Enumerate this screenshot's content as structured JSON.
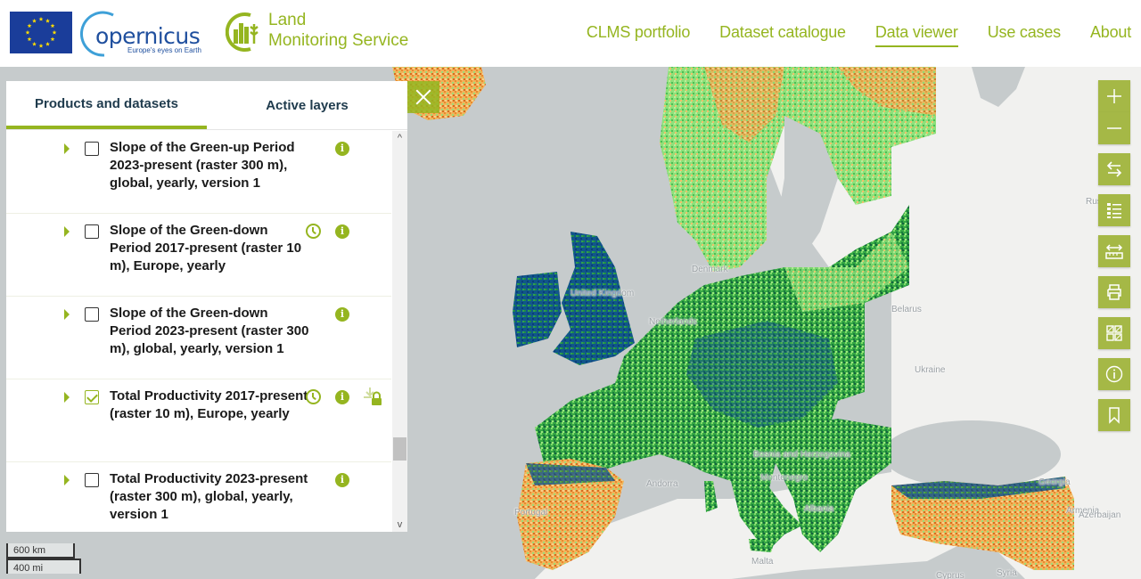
{
  "header": {
    "eu_flag_alt": "European Union flag",
    "copernicus": {
      "name": "opernicus",
      "tagline": "Europe's eyes on Earth"
    },
    "lms": {
      "line1": "Land",
      "line2": "Monitoring Service"
    },
    "nav": [
      {
        "label": "CLMS portfolio",
        "active": false
      },
      {
        "label": "Dataset catalogue",
        "active": false
      },
      {
        "label": "Data viewer",
        "active": true
      },
      {
        "label": "Use cases",
        "active": false
      },
      {
        "label": "About",
        "active": false
      }
    ]
  },
  "panel": {
    "tabs": [
      {
        "label": "Products and datasets",
        "active": true
      },
      {
        "label": "Active layers",
        "active": false
      }
    ],
    "datasets": [
      {
        "title": "Slope of the Green-up Period 2023-present (raster 300 m), global, yearly, version 1",
        "checked": false,
        "has_time": false,
        "has_download_lock": false
      },
      {
        "title": "Slope of the Green-down Period 2017-present (raster 10 m), Europe, yearly",
        "checked": false,
        "has_time": true,
        "has_download_lock": false
      },
      {
        "title": "Slope of the Green-down Period 2023-present (raster 300 m), global, yearly, version 1",
        "checked": false,
        "has_time": false,
        "has_download_lock": false
      },
      {
        "title": "Total Productivity 2017-present (raster 10 m), Europe, yearly",
        "checked": true,
        "has_time": true,
        "has_download_lock": true
      },
      {
        "title": "Total Productivity 2023-present (raster 300 m), global, yearly, version 1",
        "checked": false,
        "has_time": false,
        "has_download_lock": false
      }
    ],
    "info_glyph": "i",
    "scroll_up": "^",
    "scroll_down": "v"
  },
  "toolbar": {
    "buttons": [
      "zoom-in",
      "zoom-out",
      "compare",
      "legend",
      "measure",
      "print",
      "area-select",
      "info",
      "bookmark"
    ]
  },
  "map": {
    "labels": [
      {
        "text": "Denmark",
        "id": "denmark"
      },
      {
        "text": "United Kingdom",
        "id": "uk"
      },
      {
        "text": "Netherlands",
        "id": "netherlands"
      },
      {
        "text": "Belarus",
        "id": "belarus"
      },
      {
        "text": "Ukraine",
        "id": "ukraine"
      },
      {
        "text": "Russia",
        "id": "russia"
      },
      {
        "text": "Bosnia and Herzegovina",
        "id": "bosnia"
      },
      {
        "text": "Montenegro",
        "id": "montenegro"
      },
      {
        "text": "Andorra",
        "id": "andorra"
      },
      {
        "text": "Portugal",
        "id": "portugal"
      },
      {
        "text": "Albania",
        "id": "albania"
      },
      {
        "text": "Malta",
        "id": "malta"
      },
      {
        "text": "Georgia",
        "id": "georgia"
      },
      {
        "text": "Armenia",
        "id": "armenia"
      },
      {
        "text": "Azerbaijan",
        "id": "azerbaijan"
      },
      {
        "text": "Syria",
        "id": "syria"
      },
      {
        "text": "Cyprus",
        "id": "cyprus"
      }
    ],
    "colors": {
      "water": "#c6cbcc",
      "land_bg": "#f1f1ef",
      "high": "#0e4d8a",
      "mid": "#1f9a3a",
      "light": "#8fe07a",
      "low": "#f0a040",
      "brand": "#95b520"
    }
  },
  "scale": {
    "km": "600 km",
    "mi": "400 mi"
  }
}
